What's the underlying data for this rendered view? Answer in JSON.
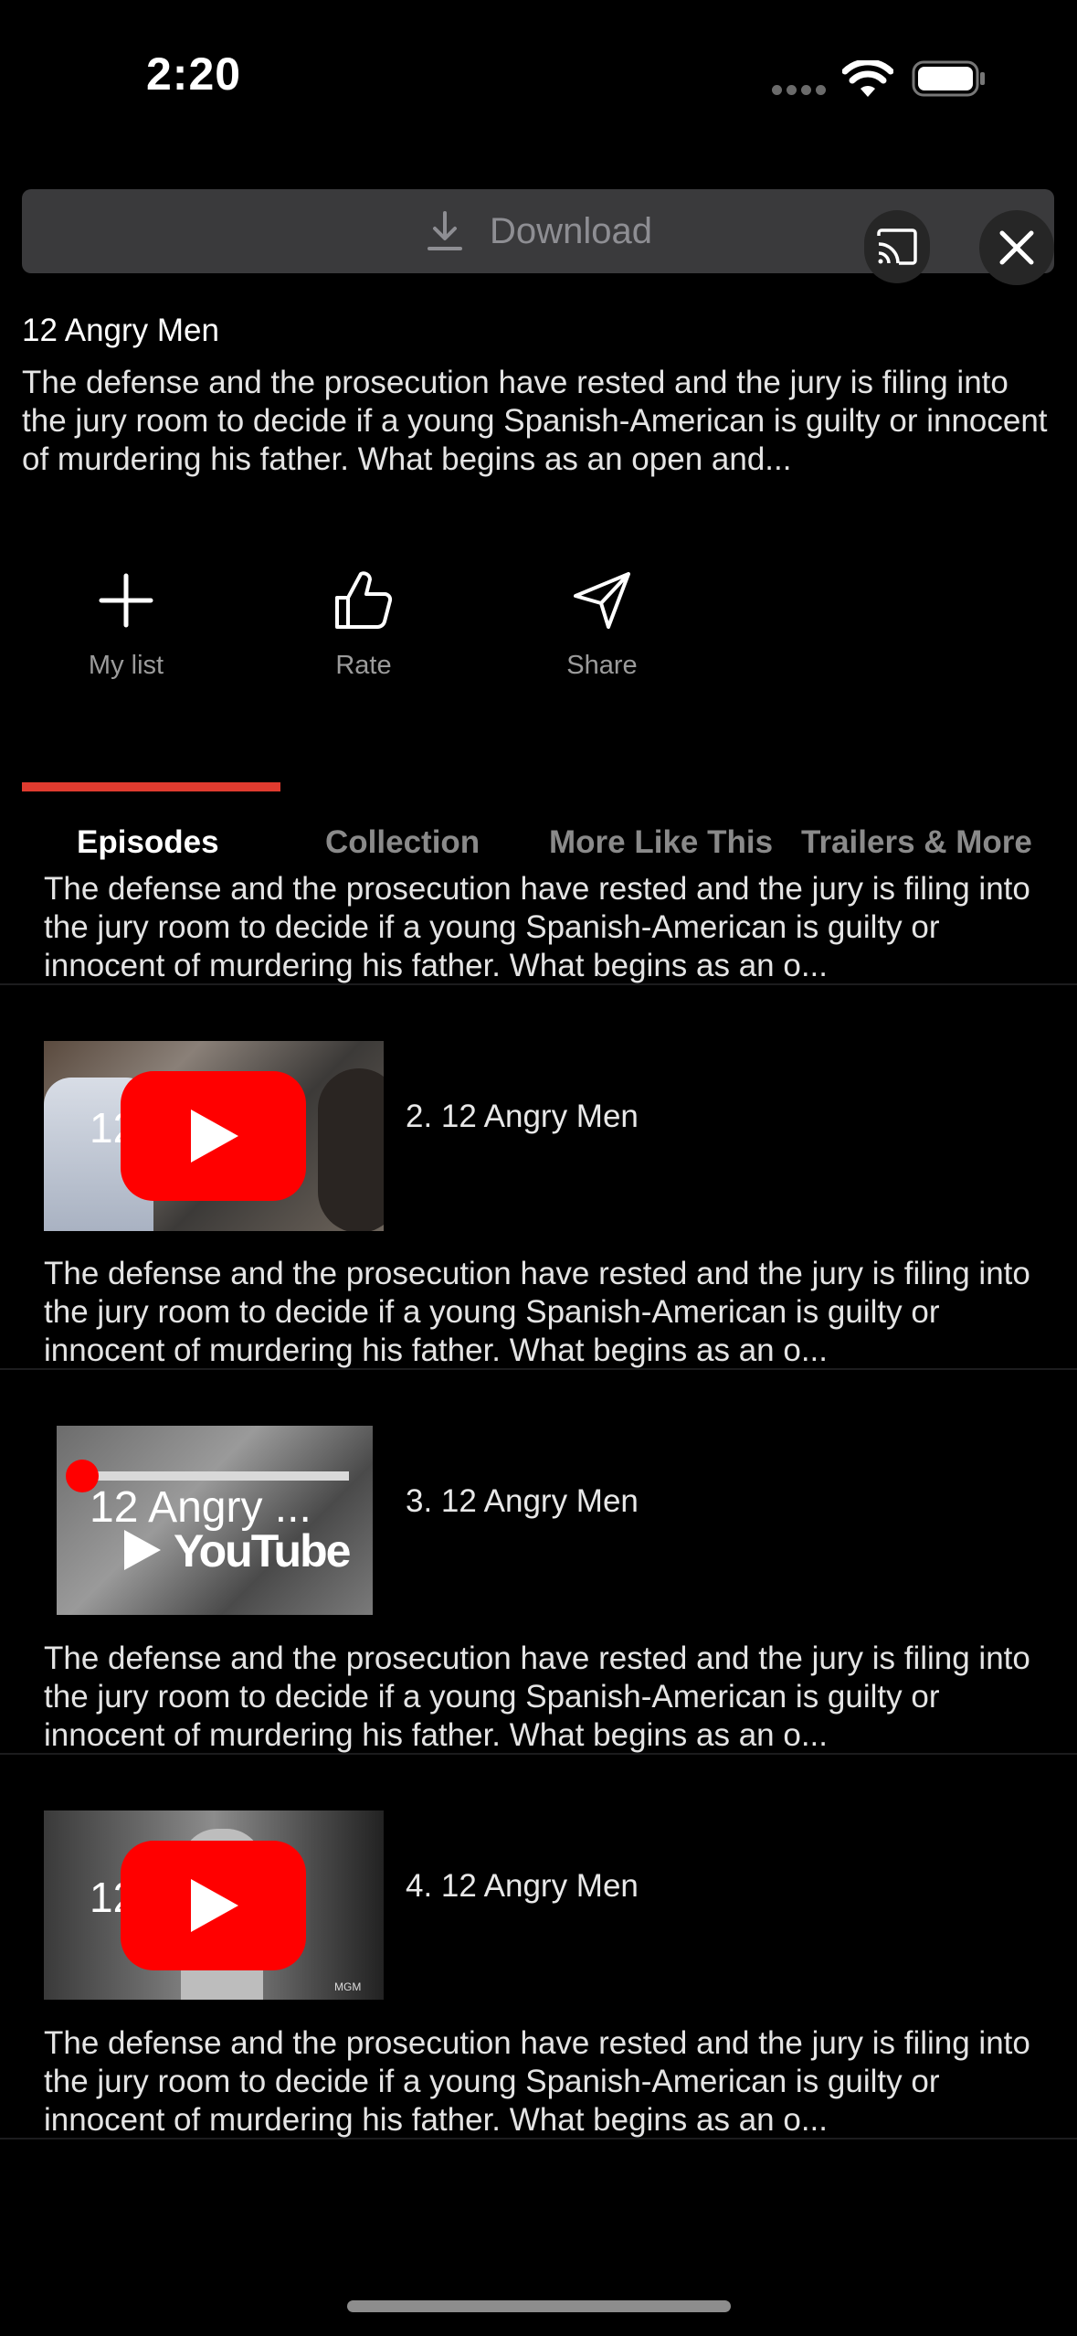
{
  "status_bar": {
    "time": "2:20"
  },
  "download": {
    "label": "Download",
    "icon": "download-icon"
  },
  "top_controls": {
    "cast_icon": "cast-icon",
    "close_icon": "close-icon"
  },
  "movie": {
    "title": "12 Angry Men",
    "synopsis": "The defense and the prosecution have rested and the jury is filing into the jury room to decide if a young Spanish-American is guilty or innocent of murdering his father. What begins as an open and..."
  },
  "actions": [
    {
      "label": "My list",
      "icon": "plus-icon"
    },
    {
      "label": "Rate",
      "icon": "thumbs-up-icon"
    },
    {
      "label": "Share",
      "icon": "send-icon"
    }
  ],
  "tabs": [
    {
      "label": "Episodes",
      "active": true
    },
    {
      "label": "Collection",
      "active": false
    },
    {
      "label": "More Like This",
      "active": false
    },
    {
      "label": "Trailers & More",
      "active": false
    }
  ],
  "accent_color": "#e03b2f",
  "episodes": [
    {
      "title": "",
      "description": "The defense and the prosecution have rested and the jury is filing into the jury room to decide if a young Spanish-American is guilty or innocent of murdering his father. What begins as an o..."
    },
    {
      "title": "2. 12 Angry Men",
      "thumb_text": "12 ..",
      "description": "The defense and the prosecution have rested and the jury is filing into the jury room to decide if a young Spanish-American is guilty or innocent of murdering his father. What begins as an o..."
    },
    {
      "title": "3. 12 Angry Men",
      "thumb_text": "12 Angry ...",
      "thumb_brand": "YouTube",
      "description": "The defense and the prosecution have rested and the jury is filing into the jury room to decide if a young Spanish-American is guilty or innocent of murdering his father. What begins as an o..."
    },
    {
      "title": "4. 12 Angry Men",
      "thumb_text": "12 ..",
      "thumb_watermark": "MGM",
      "description": "The defense and the prosecution have rested and the jury is filing into the jury room to decide if a young Spanish-American is guilty or innocent of murdering his father. What begins as an o..."
    }
  ]
}
